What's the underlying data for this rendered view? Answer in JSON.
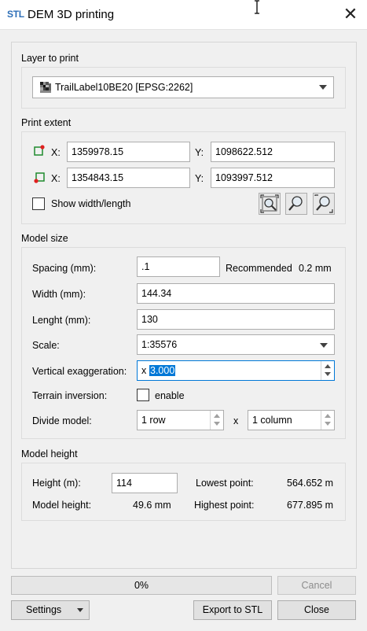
{
  "window": {
    "logo_text": "STL",
    "title": "DEM 3D printing"
  },
  "layer": {
    "section_title": "Layer to print",
    "selected": "TrailLabel10BE20 [EPSG:2262]"
  },
  "extent": {
    "section_title": "Print extent",
    "x_label": "X:",
    "y_label": "Y:",
    "top_left": {
      "x": "1359978.15",
      "y": "1098622.512"
    },
    "bottom_right": {
      "x": "1354843.15",
      "y": "1093997.512"
    },
    "show_wl_label": "Show width/length"
  },
  "model_size": {
    "section_title": "Model size",
    "spacing_label": "Spacing (mm):",
    "spacing_value": ".1",
    "recommended_label": "Recommended",
    "recommended_value": "0.2 mm",
    "width_label": "Width (mm):",
    "width_value": "144.34",
    "length_label": "Lenght (mm):",
    "length_value": "130",
    "scale_label": "Scale:",
    "scale_value": "1:35576",
    "vexag_label": "Vertical exaggeration:",
    "vexag_prefix": "x",
    "vexag_value": "3.000",
    "terrain_label": "Terrain inversion:",
    "terrain_enable": "enable",
    "divide_label": "Divide model:",
    "rows_value": "1 row",
    "x_sep": "x",
    "cols_value": "1 column"
  },
  "model_height": {
    "section_title": "Model height",
    "height_label": "Height (m):",
    "height_value": "114",
    "lowest_label": "Lowest point:",
    "lowest_value": "564.652 m",
    "model_height_label": "Model height:",
    "model_height_value": "49.6 mm",
    "highest_label": "Highest point:",
    "highest_value": "677.895 m"
  },
  "progress": {
    "text": "0%",
    "fraction": 0
  },
  "buttons": {
    "cancel": "Cancel",
    "settings": "Settings",
    "export": "Export to STL",
    "close": "Close"
  },
  "colors": {
    "accent": "#0078d7",
    "logo": "#2e6fb8",
    "marker_red": "#e02020",
    "marker_green": "#1f8a2e"
  }
}
